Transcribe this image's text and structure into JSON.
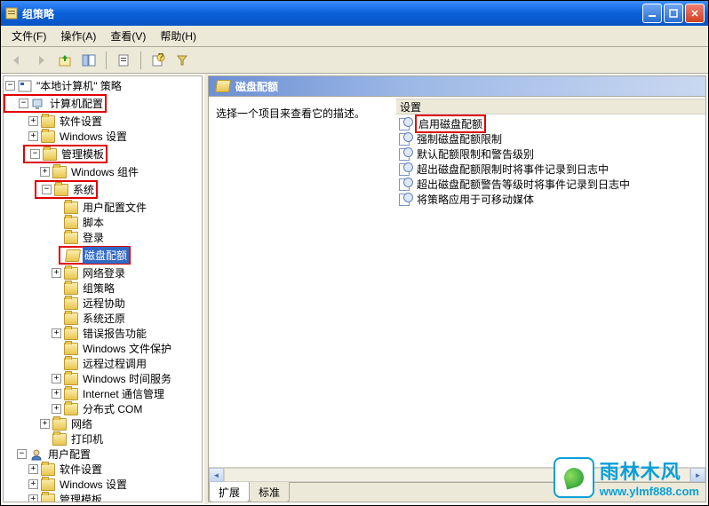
{
  "window": {
    "title": "组策略"
  },
  "menu": {
    "file": "文件(F)",
    "action": "操作(A)",
    "view": "查看(V)",
    "help": "帮助(H)"
  },
  "tree": {
    "root": "\"本地计算机\" 策略",
    "computer_config": "计算机配置",
    "software_settings": "软件设置",
    "windows_settings": "Windows 设置",
    "admin_templates": "管理模板",
    "windows_components": "Windows 组件",
    "system": "系统",
    "user_profiles": "用户配置文件",
    "scripts": "脚本",
    "logon": "登录",
    "disk_quota": "磁盘配额",
    "net_logon": "网络登录",
    "group_policy": "组策略",
    "remote_assist": "远程协助",
    "system_restore": "系统还原",
    "error_report": "错误报告功能",
    "win_file_protect": "Windows 文件保护",
    "rpc": "远程过程调用",
    "win_time": "Windows 时间服务",
    "internet_comm": "Internet 通信管理",
    "dcom": "分布式 COM",
    "network": "网络",
    "printers": "打印机",
    "user_config": "用户配置",
    "u_software": "软件设置",
    "u_windows": "Windows 设置",
    "u_admin": "管理模板"
  },
  "content": {
    "title": "磁盘配额",
    "desc": "选择一个项目来查看它的描述。",
    "col_header": "设置",
    "settings": [
      "启用磁盘配额",
      "强制磁盘配额限制",
      "默认配额限制和警告级别",
      "超出磁盘配额限制时将事件记录到日志中",
      "超出磁盘配额警告等级时将事件记录到日志中",
      "将策略应用于可移动媒体"
    ],
    "tab_ext": "扩展",
    "tab_std": "标准"
  },
  "watermark": {
    "cn": "雨林木风",
    "url": "www.ylmf888.com"
  }
}
